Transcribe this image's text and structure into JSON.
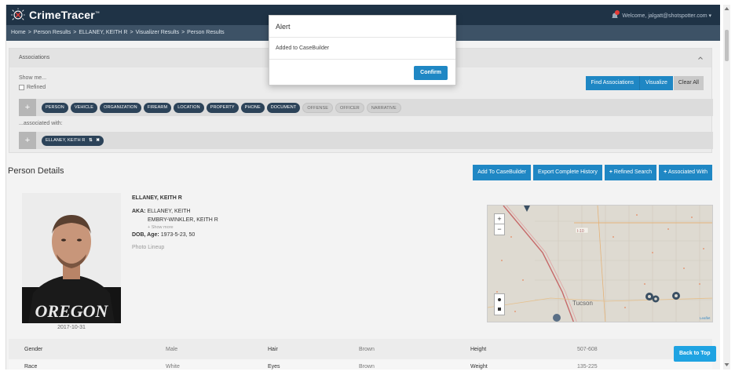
{
  "app": {
    "name": "CrimeTracer",
    "tm": "™"
  },
  "header": {
    "welcome": "Welcome, jalgatt@shotspotter.com ▾"
  },
  "breadcrumb": [
    "Home",
    "Person Results",
    "ELLANEY, KEITH R",
    "Visualizer Results",
    "Person Results"
  ],
  "breadcrumb_sep": ">",
  "associations": {
    "title": "Associations",
    "show_me": "Show me...",
    "refined": "Refined",
    "buttons": {
      "find": "Find Associations",
      "visualize": "Visualize",
      "clear": "Clear All"
    },
    "plus": "+",
    "chips_active": [
      "PERSON",
      "VEHICLE",
      "ORGANIZATION",
      "FIREARM",
      "LOCATION",
      "PROPERTY",
      "PHONE",
      "DOCUMENT"
    ],
    "chips_inactive": [
      "OFFENSE",
      "OFFICER",
      "NARRATIVE"
    ],
    "associated_with": "...associated with:",
    "selected_chip": "ELLANEY, KEITH R",
    "selected_chip_swap": "⇅",
    "selected_chip_close": "✖"
  },
  "person_details": {
    "title": "Person Details",
    "buttons": {
      "add_casebuilder": "Add To CaseBuilder",
      "export": "Export Complete History",
      "refined_search": "Refined Search",
      "associated_with": "Associated With"
    },
    "plus_icon": "+",
    "name": "ELLANEY, KEITH R",
    "aka_label": "AKA:",
    "aka": [
      "ELLANEY, KEITH",
      "EMBRY-WINKLER, KEITH R"
    ],
    "show_more": "+ Show more",
    "dob_label": "DOB, Age:",
    "dob_value": "1973-5-23, 50",
    "photo_lineup": "Photo Lineup",
    "photo_date": "2017-10-31",
    "shirt_text": "OREGON"
  },
  "map": {
    "zoom_in": "+",
    "zoom_out": "−",
    "city_label": "Tucson",
    "highway_label": "I-10",
    "attribution": "Leaflet"
  },
  "details_grid": {
    "row1": [
      {
        "key": "Gender",
        "value": "Male"
      },
      {
        "key": "Hair",
        "value": "Brown"
      },
      {
        "key": "Height",
        "value": "507-608"
      }
    ],
    "row2": [
      {
        "key": "Race",
        "value": "White"
      },
      {
        "key": "Eyes",
        "value": "Brown"
      },
      {
        "key": "Weight",
        "value": "135-225"
      }
    ]
  },
  "back_to_top": "Back to Top",
  "modal": {
    "title": "Alert",
    "message": "Added to CaseBuilder",
    "confirm": "Confirm"
  },
  "colors": {
    "topbar": "#1f3346",
    "breadcrumb": "#3d5266",
    "primary": "#1f87c4",
    "chip_active": "#2c4359",
    "back_to_top": "#1fa3e2"
  }
}
